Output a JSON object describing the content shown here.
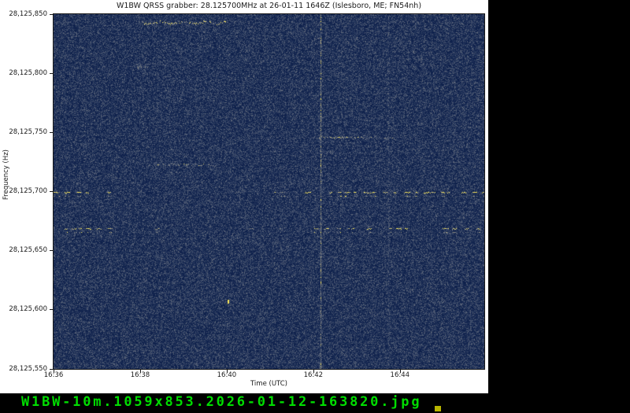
{
  "window": {
    "background": "#000000"
  },
  "figure": {
    "background": "#ffffff"
  },
  "chart_data": {
    "type": "heatmap",
    "subtype": "qrss-spectrogram-waterfall",
    "title": "W1BW QRSS grabber: 28.125700MHz at 26-01-11 1646Z (Islesboro, ME; FN54nh)",
    "xlabel": "Time (UTC)",
    "ylabel": "Frequency (Hz)",
    "ylim_hz": [
      28125550,
      28125850
    ],
    "xlim_minutes": [
      0,
      9.95
    ],
    "time_start_label": "16:36",
    "x_ticks": [
      {
        "label": "16:36",
        "t_min": 0
      },
      {
        "label": "16:38",
        "t_min": 2
      },
      {
        "label": "16:40",
        "t_min": 4
      },
      {
        "label": "16:42",
        "t_min": 6
      },
      {
        "label": "16:44",
        "t_min": 8
      }
    ],
    "y_ticks": [
      {
        "label": "28,125,850",
        "hz": 28125850
      },
      {
        "label": "28,125,800",
        "hz": 28125800
      },
      {
        "label": "28,125,750",
        "hz": 28125750
      },
      {
        "label": "28,125,700",
        "hz": 28125700
      },
      {
        "label": "28,125,650",
        "hz": 28125650
      },
      {
        "label": "28,125,600",
        "hz": 28125600
      },
      {
        "label": "28,125,550",
        "hz": 28125550
      }
    ],
    "legend": "none",
    "grid": false,
    "colormap_stops": [
      {
        "v": 0.0,
        "rgb": [
          6,
          25,
          70
        ]
      },
      {
        "v": 0.35,
        "rgb": [
          52,
          68,
          102
        ]
      },
      {
        "v": 0.62,
        "rgb": [
          112,
          118,
          130
        ]
      },
      {
        "v": 0.85,
        "rgb": [
          185,
          175,
          135
        ]
      },
      {
        "v": 1.0,
        "rgb": [
          250,
          232,
          92
        ]
      }
    ],
    "noise": {
      "floor": 0.05,
      "range": 0.52,
      "gamma": 2.0,
      "seed": 987654321
    },
    "signals": [
      {
        "kind": "trace",
        "hz": 28125843,
        "t0": 2.04,
        "t1": 3.97,
        "level": 0.8,
        "spread": 2.5,
        "wavy": true,
        "density": 0.75
      },
      {
        "kind": "blob",
        "hz": 28125806,
        "t": 1.96,
        "r": 4,
        "level": 0.28
      },
      {
        "kind": "blob",
        "hz": 28125806,
        "t": 2.12,
        "r": 3,
        "level": 0.22
      },
      {
        "kind": "trace",
        "hz": 28125723,
        "t0": 2.18,
        "t1": 3.64,
        "level": 0.45,
        "spread": 2.0,
        "wavy": false,
        "density": 0.6
      },
      {
        "kind": "trace",
        "hz": 28125746,
        "t0": 6.13,
        "t1": 7.05,
        "level": 0.6,
        "spread": 1.5,
        "wavy": false,
        "density": 0.8
      },
      {
        "kind": "trace",
        "hz": 28125746,
        "t0": 7.05,
        "t1": 7.85,
        "level": 0.38,
        "spread": 1.5,
        "wavy": false,
        "density": 0.5
      },
      {
        "kind": "dashline",
        "hz": 28125700,
        "segments": [
          {
            "t0": 0.0,
            "t1": 1.32,
            "density": 0.85,
            "level": 0.85
          },
          {
            "t0": 1.32,
            "t1": 5.8,
            "density": 0.18,
            "level": 0.5
          },
          {
            "t0": 5.8,
            "t1": 9.95,
            "density": 0.9,
            "level": 0.9
          }
        ]
      },
      {
        "kind": "dashline",
        "hz": 28125669,
        "segments": [
          {
            "t0": 0.0,
            "t1": 1.62,
            "density": 0.8,
            "level": 0.8
          },
          {
            "t0": 1.62,
            "t1": 5.8,
            "density": 0.1,
            "level": 0.4
          },
          {
            "t0": 5.8,
            "t1": 9.95,
            "density": 0.8,
            "level": 0.8
          }
        ]
      },
      {
        "kind": "vline",
        "t": 6.16,
        "level": 0.5,
        "width": 1
      },
      {
        "kind": "vline",
        "t": 7.73,
        "level": 0.15,
        "width": 3
      },
      {
        "kind": "dot",
        "hz": 28125607,
        "t": 4.02,
        "level": 1.2
      }
    ]
  },
  "viewer_bar": {
    "filename": "W1BW-10m.1059x853.2026-01-12-163820.jpg",
    "text_color": "#00dd00",
    "cursor_color": "#b8b500"
  }
}
